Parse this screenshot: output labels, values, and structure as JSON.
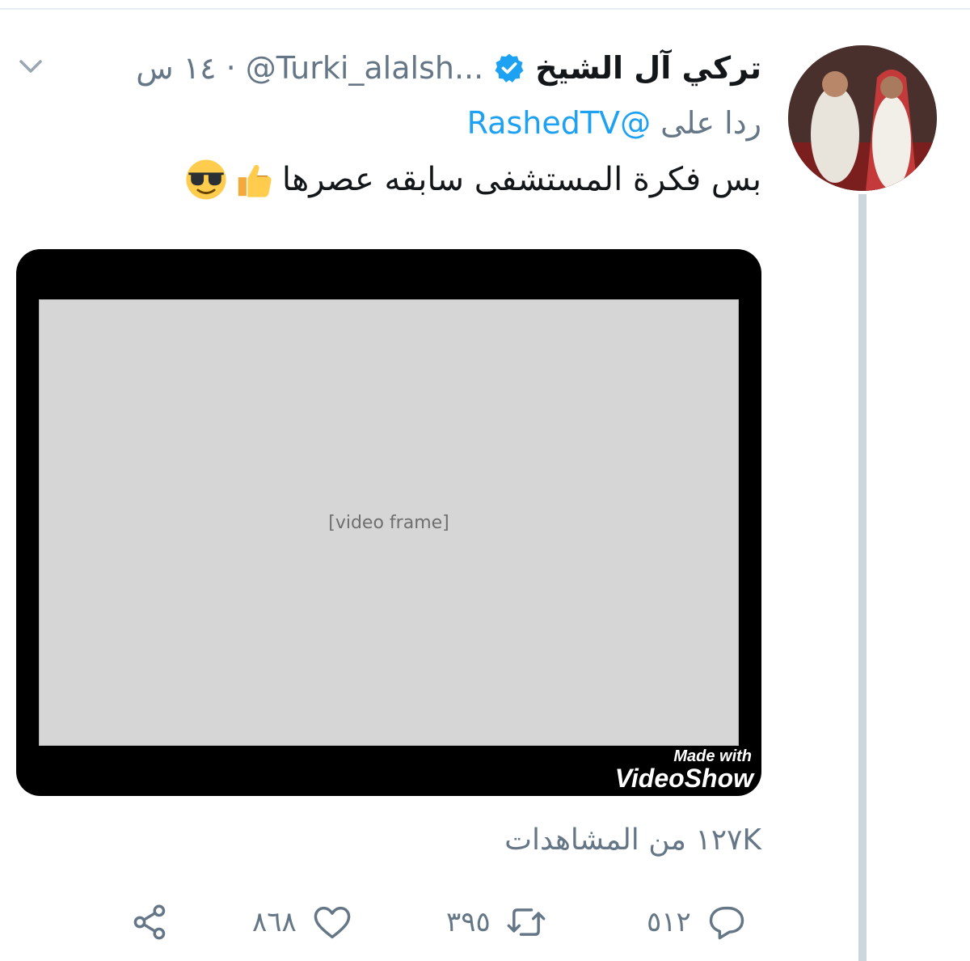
{
  "tweet": {
    "display_name": "تركي آل الشيخ",
    "handle": "@Turki_alalsh...",
    "separator": "·",
    "time": "١٤ س",
    "reply_prefix": "ردا على",
    "reply_to": "@RashedTV",
    "text": "بس فكرة المستشفى سابقه عصرها",
    "emoji": [
      "thumbs-up",
      "smiling-face-with-sunglasses"
    ],
    "views": "١٢٧K من المشاهدات"
  },
  "media": {
    "watermark_line1": "Made with",
    "watermark_line2": "VideoShow"
  },
  "actions": {
    "reply_count": "٥١٢",
    "retweet_count": "٣٩٥",
    "like_count": "٨٦٨"
  },
  "colors": {
    "accent": "#1da1f2",
    "secondary_text": "#657786",
    "thread_line": "#ccd6dd"
  }
}
